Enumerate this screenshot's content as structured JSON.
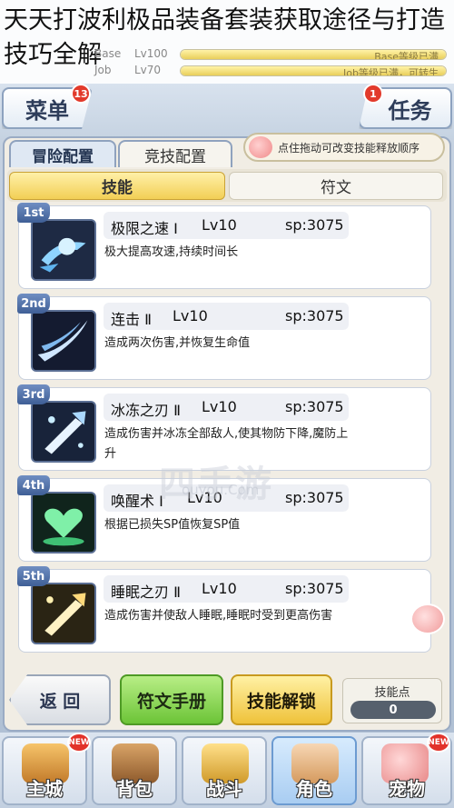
{
  "article_title": "天天打波利极品装备套装获取途径与打造技巧全解",
  "stats": {
    "base_key": "Base",
    "base_level": "Lv100",
    "base_bar_text": "Base等级已满",
    "base_progress": 1.0,
    "job_key": "Job",
    "job_level": "Lv70",
    "job_bar_text": "Job等级已满，可转生",
    "job_progress": 1.0
  },
  "header": {
    "menu_label": "菜单",
    "menu_badge": "13",
    "task_label": "任务",
    "task_badge": "1"
  },
  "tabs": {
    "adventure": "冒险配置",
    "arena": "竞技配置"
  },
  "hint": "点住拖动可改变技能释放顺序",
  "subtabs": {
    "skills": "技能",
    "runes": "符文"
  },
  "skills": [
    {
      "rank": "1st",
      "name": "极限之速 Ⅰ",
      "level": "Lv10",
      "sp": "sp:3075",
      "desc": "极大提高攻速,持续时间长"
    },
    {
      "rank": "2nd",
      "name": "连击 Ⅱ",
      "level": "Lv10",
      "sp": "sp:3075",
      "desc": "造成两次伤害,并恢复生命值"
    },
    {
      "rank": "3rd",
      "name": "冰冻之刃 Ⅱ",
      "level": "Lv10",
      "sp": "sp:3075",
      "desc": "造成伤害并冰冻全部敌人,使其物防下降,魔防上升"
    },
    {
      "rank": "4th",
      "name": "唤醒术 Ⅰ",
      "level": "Lv10",
      "sp": "sp:3075",
      "desc": "根据已损失SP值恢复SP值"
    },
    {
      "rank": "5th",
      "name": "睡眠之刃 Ⅱ",
      "level": "Lv10",
      "sp": "sp:3075",
      "desc": "造成伤害并使敌人睡眠,睡眠时受到更高伤害"
    }
  ],
  "actions": {
    "back": "返 回",
    "rune_manual": "符文手册",
    "skill_unlock": "技能解锁",
    "skill_points_label": "技能点",
    "skill_points_value": "0"
  },
  "watermark": "四手游",
  "watermark_small": "ouyou.Com",
  "nav": [
    {
      "label": "主城",
      "tag": "NEW"
    },
    {
      "label": "背包",
      "tag": ""
    },
    {
      "label": "战斗",
      "tag": ""
    },
    {
      "label": "角色",
      "tag": ""
    },
    {
      "label": "宠物",
      "tag": "NEW"
    }
  ],
  "colors": {
    "accent_yellow": "#f2cf55",
    "accent_green": "#6cc437",
    "badge_red": "#e23a2b",
    "rank_blue": "#4f6fa8"
  }
}
